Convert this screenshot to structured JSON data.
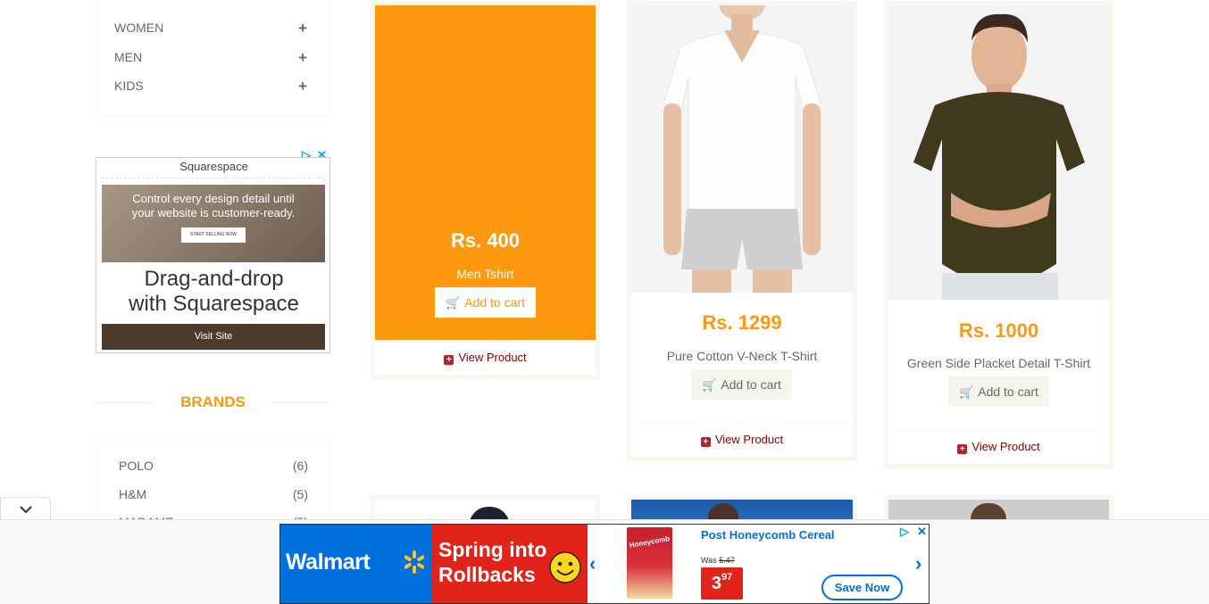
{
  "categories": [
    {
      "label": "WOMEN",
      "icon": "plus-icon"
    },
    {
      "label": "MEN",
      "icon": "plus-icon"
    },
    {
      "label": "KIDS",
      "icon": "plus-icon"
    }
  ],
  "side_ad": {
    "sponsor": "Squarespace",
    "headline_1": "Control every design detail until",
    "headline_2": "your website is customer-ready.",
    "cta_small": "START SELLING NOW",
    "body_1": "Drag-and-drop",
    "body_2": "with Squarespace",
    "button": "Visit Site"
  },
  "brands": {
    "title": "BRANDS",
    "items": [
      {
        "name": "POLO",
        "count": "(6)"
      },
      {
        "name": "H&M",
        "count": "(5)"
      },
      {
        "name": "MADAME",
        "count": "(5)"
      }
    ]
  },
  "products": [
    {
      "price": "Rs. 400",
      "name": "Men Tshirt",
      "cart_label": "Add to cart",
      "view_label": "View Product",
      "hovered": true
    },
    {
      "price": "Rs. 1299",
      "name": "Pure Cotton V-Neck T-Shirt",
      "cart_label": "Add to cart",
      "view_label": "View Product",
      "image": "white-tshirt"
    },
    {
      "price": "Rs. 1000",
      "name": "Green Side Placket Detail T-Shirt",
      "cart_label": "Add to cart",
      "view_label": "View Product",
      "image": "green-shirt"
    }
  ],
  "bottom_ad": {
    "brand": "Walmart",
    "promo_1": "Spring into",
    "promo_2": "Rollbacks",
    "box_label": "Honeycomb",
    "product": "Post Honeycomb Cereal",
    "was_label": "Was",
    "was_price": "5.47",
    "price_main": "3",
    "price_cents": "97",
    "button": "Save Now",
    "prev_arrow": "‹",
    "next_arrow": "›"
  },
  "colors": {
    "accent": "#fe980f",
    "view_link": "#8b0000",
    "walmart_blue": "#0071dc",
    "walmart_red": "#e2231a"
  }
}
